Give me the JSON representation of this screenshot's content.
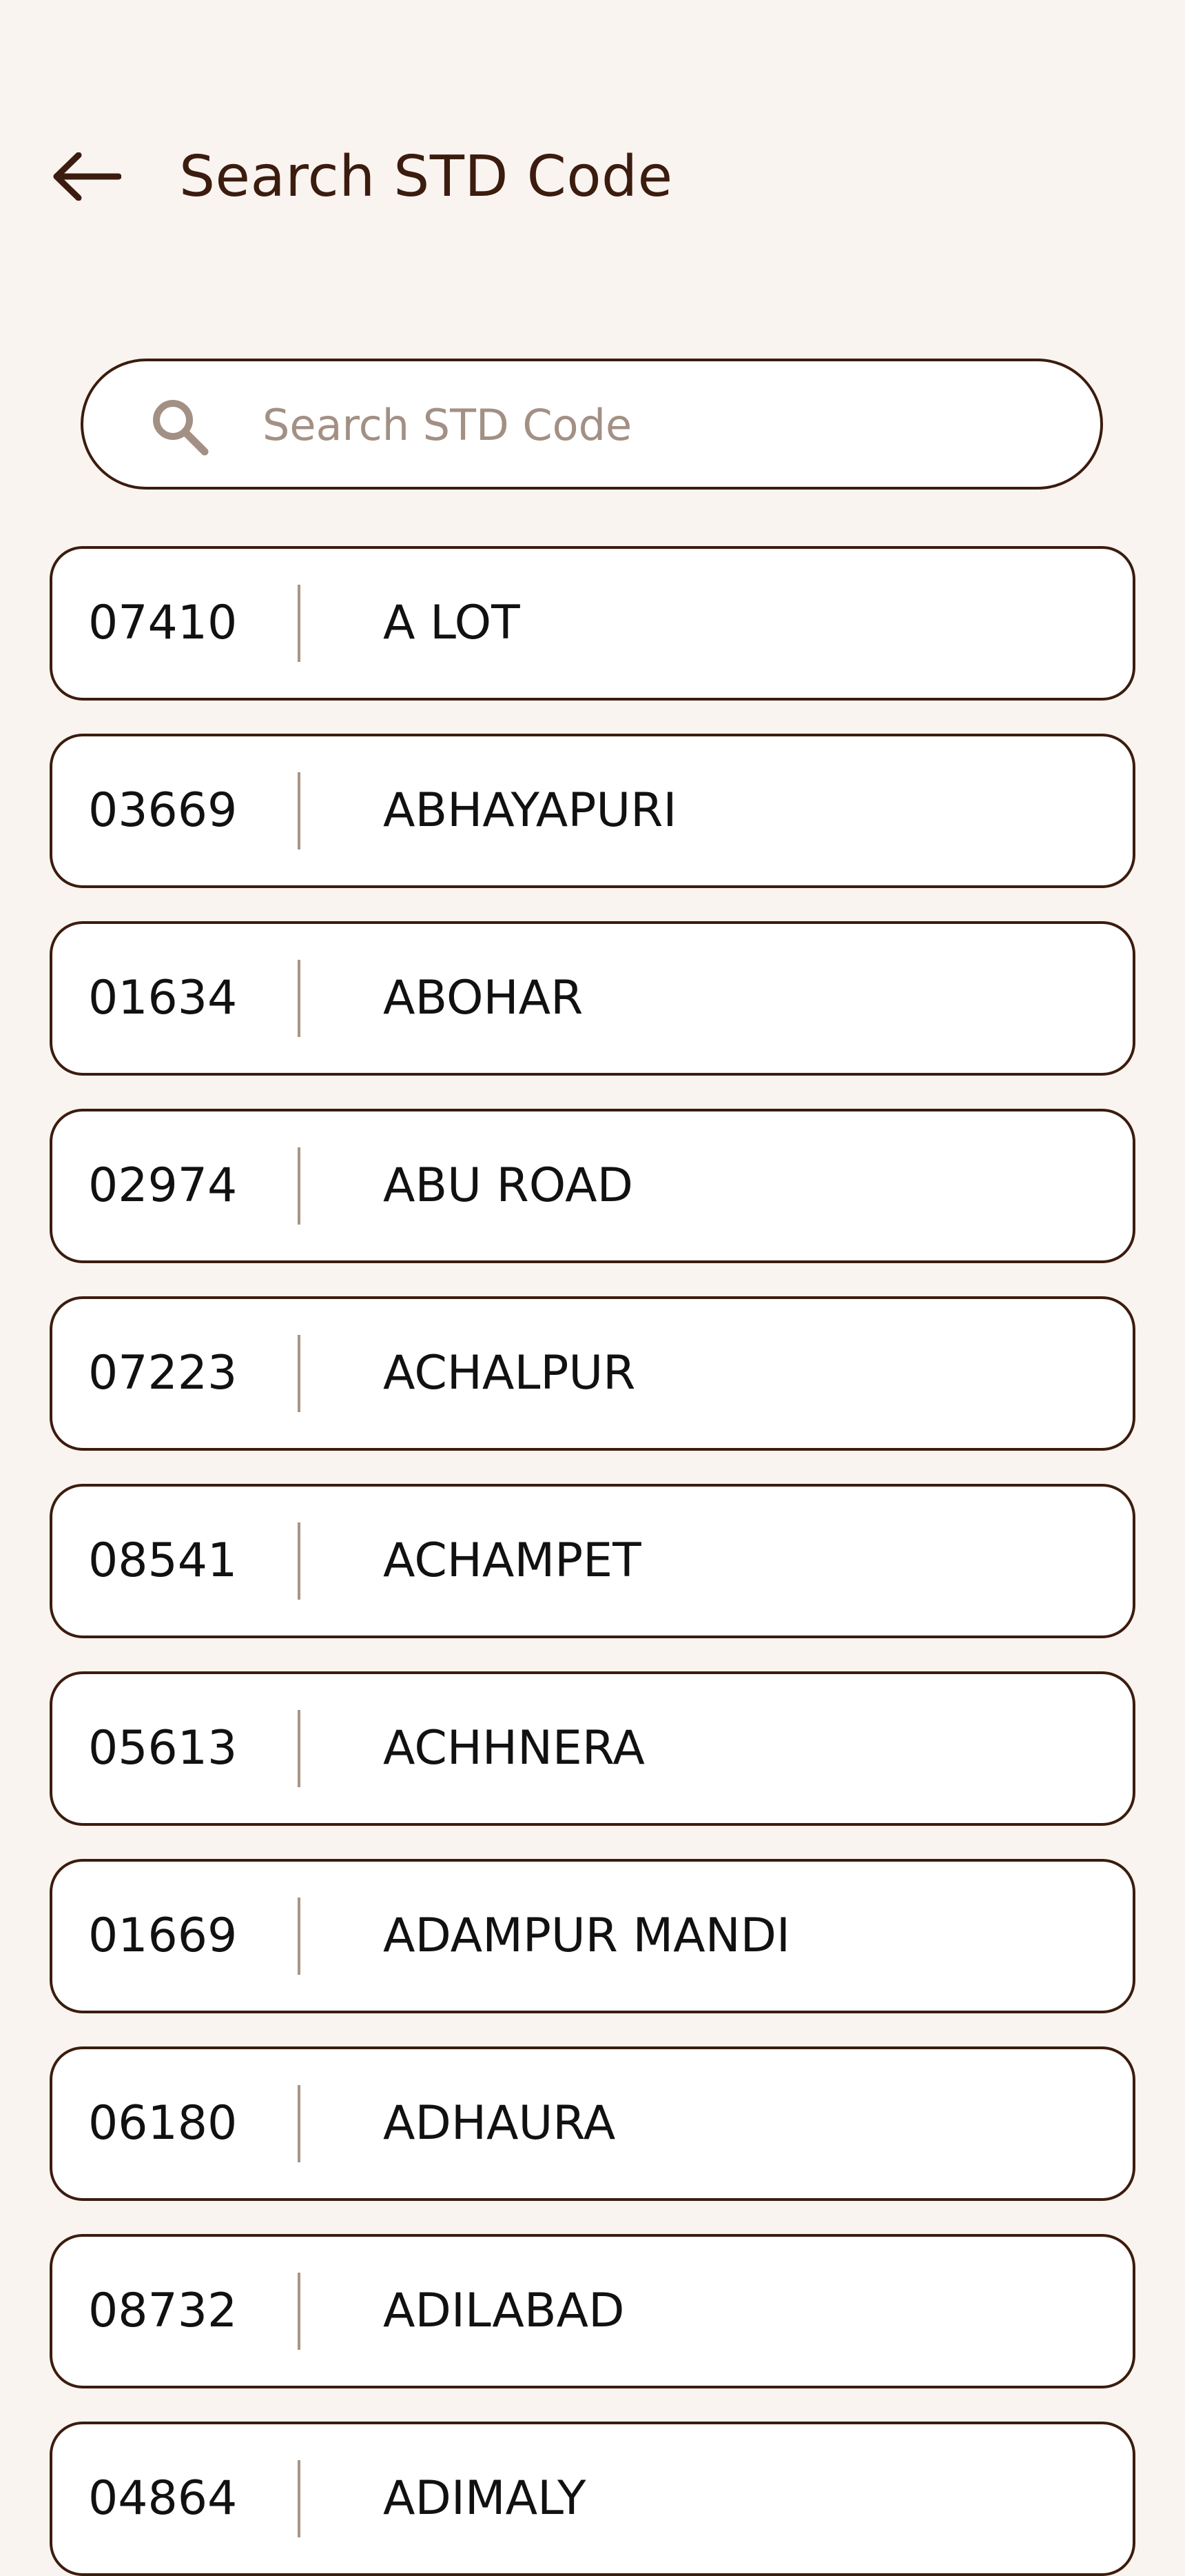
{
  "header": {
    "title": "Search STD Code",
    "back_icon": "arrow-left-icon"
  },
  "search": {
    "placeholder": "Search STD Code",
    "value": "",
    "icon": "search-icon"
  },
  "colors": {
    "background": "#faf4f0",
    "accent": "#3b1c0e",
    "placeholder": "#a39084",
    "divider": "#a89585"
  },
  "items": [
    {
      "code": "07410",
      "city": "A LOT"
    },
    {
      "code": "03669",
      "city": "ABHAYAPURI"
    },
    {
      "code": "01634",
      "city": "ABOHAR"
    },
    {
      "code": "02974",
      "city": "ABU ROAD"
    },
    {
      "code": "07223",
      "city": "ACHALPUR"
    },
    {
      "code": "08541",
      "city": "ACHAMPET"
    },
    {
      "code": "05613",
      "city": "ACHHNERA"
    },
    {
      "code": "01669",
      "city": "ADAMPUR MANDI"
    },
    {
      "code": "06180",
      "city": "ADHAURA"
    },
    {
      "code": "08732",
      "city": "ADILABAD"
    },
    {
      "code": "04864",
      "city": "ADIMALY"
    }
  ]
}
